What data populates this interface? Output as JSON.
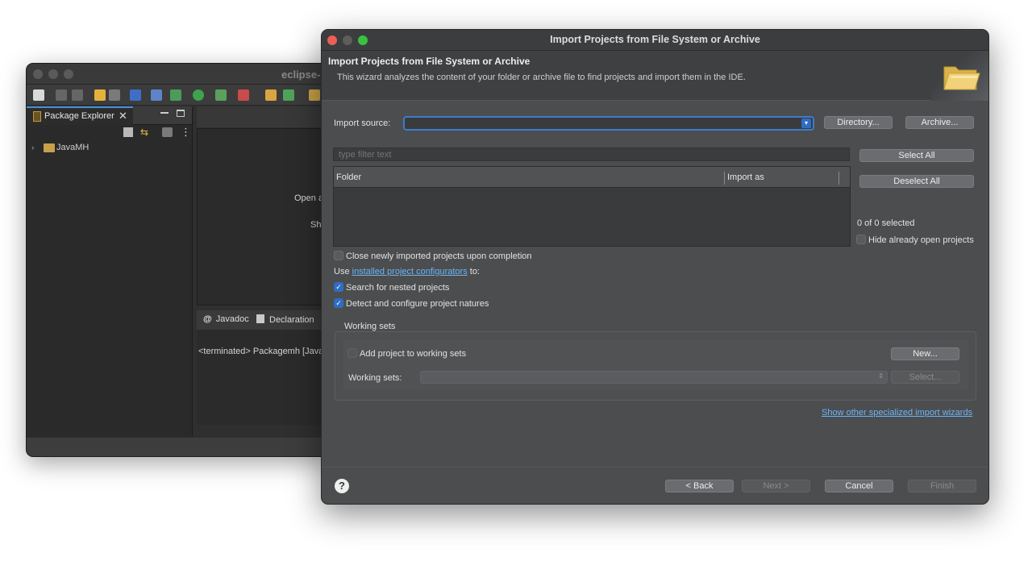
{
  "background_window": {
    "title": "eclipse-",
    "package_explorer_tab": "Package Explorer",
    "tree_project": "JavaMH",
    "editor_open_text": "Open a",
    "editor_sh_text": "Sh",
    "bottom_tabs": [
      "Javadoc",
      "Declaration"
    ],
    "console_line": "<terminated> Packagemh [Java"
  },
  "dialog": {
    "window_title": "Import Projects from File System or Archive",
    "header_title": "Import Projects from File System or Archive",
    "header_description": "This wizard analyzes the content of your folder or archive file to find projects and import them in the IDE.",
    "import_source_label": "Import source:",
    "import_source_value": "",
    "directory_button": "Directory...",
    "archive_button": "Archive...",
    "filter_placeholder": "type filter text",
    "select_all_button": "Select All",
    "deselect_all_button": "Deselect All",
    "table_columns": [
      "Folder",
      "Import as"
    ],
    "selected_count": "0 of 0 selected",
    "hide_open_label": "Hide already open projects",
    "close_newly_label": "Close newly imported projects upon completion",
    "use_prefix": "Use ",
    "configurators_link": "installed project configurators",
    "use_suffix": " to:",
    "search_nested_label": "Search for nested projects",
    "detect_configure_label": "Detect and configure project natures",
    "working_sets_group": "Working sets",
    "add_to_ws_label": "Add project to working sets",
    "new_button": "New...",
    "working_sets_label": "Working sets:",
    "ws_select_button": "Select...",
    "other_wizards_link": "Show other specialized import wizards",
    "back_button": "< Back",
    "next_button": "Next >",
    "cancel_button": "Cancel",
    "finish_button": "Finish",
    "checkbox_states": {
      "close_newly": false,
      "hide_open": false,
      "search_nested": true,
      "detect_configure": true,
      "add_to_ws": false
    }
  }
}
